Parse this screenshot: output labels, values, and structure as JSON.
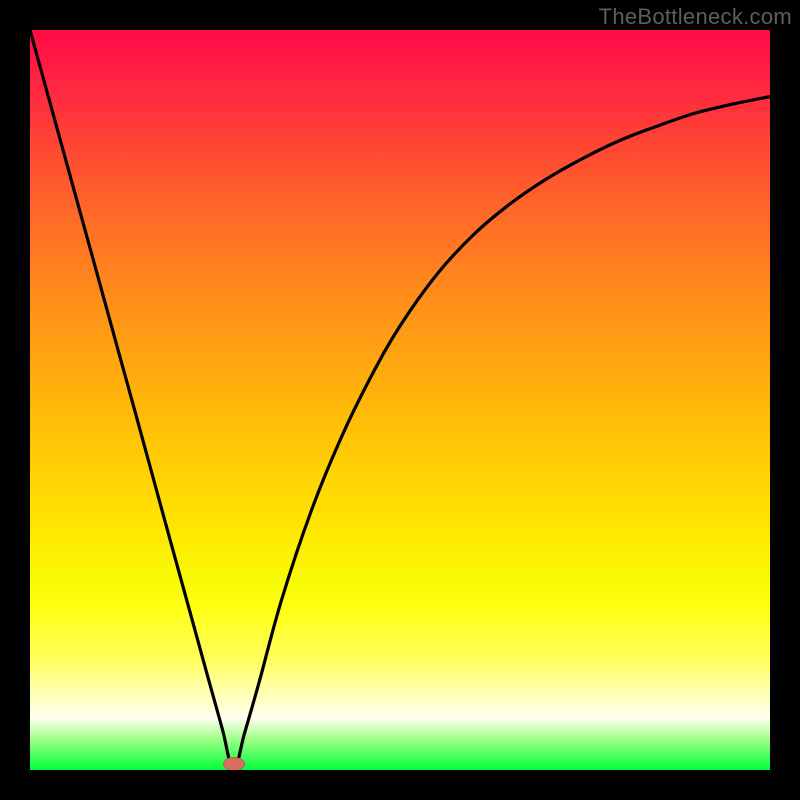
{
  "watermark": "TheBottleneck.com",
  "marker": {
    "x_frac": 0.275,
    "y_frac": 0.992
  },
  "chart_data": {
    "type": "line",
    "title": "",
    "xlabel": "",
    "ylabel": "",
    "xlim": [
      0,
      1
    ],
    "ylim": [
      0,
      1
    ],
    "series": [
      {
        "name": "bottleneck-curve",
        "x": [
          0.0,
          0.03,
          0.06,
          0.09,
          0.12,
          0.15,
          0.18,
          0.21,
          0.24,
          0.26,
          0.275,
          0.29,
          0.31,
          0.34,
          0.38,
          0.42,
          0.46,
          0.5,
          0.55,
          0.6,
          0.65,
          0.7,
          0.75,
          0.8,
          0.85,
          0.9,
          0.95,
          1.0
        ],
        "y": [
          1.0,
          0.891,
          0.782,
          0.673,
          0.564,
          0.455,
          0.345,
          0.236,
          0.127,
          0.055,
          0.0,
          0.05,
          0.12,
          0.23,
          0.35,
          0.448,
          0.53,
          0.6,
          0.67,
          0.724,
          0.766,
          0.8,
          0.828,
          0.852,
          0.871,
          0.888,
          0.9,
          0.91
        ]
      }
    ],
    "annotations": [
      {
        "text": "TheBottleneck.com",
        "role": "watermark",
        "position": "top-right"
      }
    ],
    "grid": false,
    "legend": false,
    "background_gradient": {
      "orientation": "vertical",
      "stops": [
        {
          "offset": 0.0,
          "color": "#ff0a46"
        },
        {
          "offset": 0.5,
          "color": "#ffaf0c"
        },
        {
          "offset": 0.78,
          "color": "#ffff12"
        },
        {
          "offset": 1.0,
          "color": "#00ff3a"
        }
      ]
    }
  }
}
